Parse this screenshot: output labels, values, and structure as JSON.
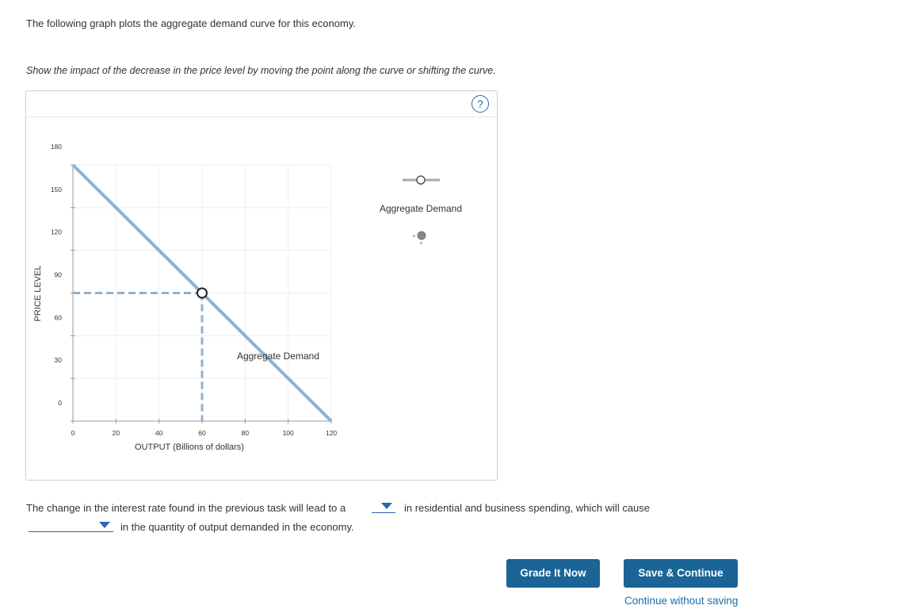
{
  "intro_text": "The following graph plots the aggregate demand curve for this economy.",
  "instruction_text": "Show the impact of the decrease in the price level by moving the point along the curve or shifting the curve.",
  "help_label": "?",
  "chart_data": {
    "type": "line",
    "xlabel": "OUTPUT (Billions of dollars)",
    "ylabel": "PRICE LEVEL",
    "xlim": [
      0,
      120
    ],
    "ylim": [
      0,
      180
    ],
    "x_ticks": [
      "0",
      "20",
      "40",
      "60",
      "80",
      "100",
      "120"
    ],
    "y_ticks": [
      "0",
      "30",
      "60",
      "90",
      "120",
      "150",
      "180"
    ],
    "grid": true,
    "series": [
      {
        "name": "Aggregate Demand",
        "x": [
          0,
          120
        ],
        "y": [
          180,
          0
        ],
        "color": "#8eb1cf"
      }
    ],
    "point": {
      "x": 60,
      "y": 90
    },
    "curve_label": "Aggregate Demand"
  },
  "palette": {
    "legend_item_label": "Aggregate Demand"
  },
  "question": {
    "line1_before": "The change in the interest rate found in the previous task will lead to a",
    "line1_after": "in residential and business spending, which will cause",
    "line2_after": "in the quantity of output demanded in the economy.",
    "dropdown1_value": "",
    "dropdown2_value": ""
  },
  "buttons": {
    "grade": "Grade It Now",
    "save": "Save & Continue",
    "continue_link": "Continue without saving"
  },
  "colors": {
    "accent": "#1a6496",
    "curve": "#8eb1cf",
    "link": "#1a6ea8"
  }
}
